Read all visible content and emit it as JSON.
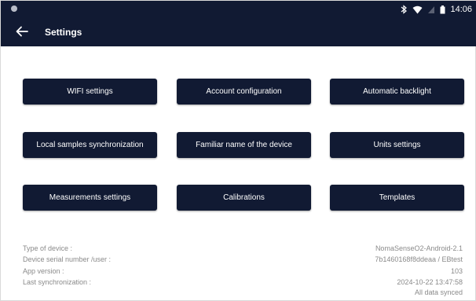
{
  "status_bar": {
    "time": "14:06",
    "icons": [
      "app-dot-icon",
      "bluetooth-icon",
      "wifi-icon",
      "signal-icon",
      "battery-icon"
    ]
  },
  "app_bar": {
    "title": "Settings",
    "back_icon": "arrow-left-icon"
  },
  "buttons": [
    {
      "id": "wifi",
      "label": "WIFI settings"
    },
    {
      "id": "account",
      "label": "Account configuration"
    },
    {
      "id": "backlight",
      "label": "Automatic backlight"
    },
    {
      "id": "local-sync",
      "label": "Local samples synchronization"
    },
    {
      "id": "familiar-name",
      "label": "Familiar name of the device"
    },
    {
      "id": "units",
      "label": "Units settings"
    },
    {
      "id": "measurements",
      "label": "Measurements settings"
    },
    {
      "id": "calibrations",
      "label": "Calibrations"
    },
    {
      "id": "templates",
      "label": "Templates"
    }
  ],
  "device_info": {
    "type_label": "Type of device :",
    "type_value": "NomaSenseO2-Android-2.1",
    "serial_label": "Device serial number /user :",
    "serial_value": "7b1460168f8ddeaa / EBtest",
    "app_version_label": "App version :",
    "app_version_value": "103",
    "last_sync_label": "Last synchronization :",
    "last_sync_value": "2024-10-22 13:47:58",
    "sync_status": "All data synced"
  },
  "colors": {
    "primary": "#111a33",
    "muted_text": "#8a8a8a"
  }
}
